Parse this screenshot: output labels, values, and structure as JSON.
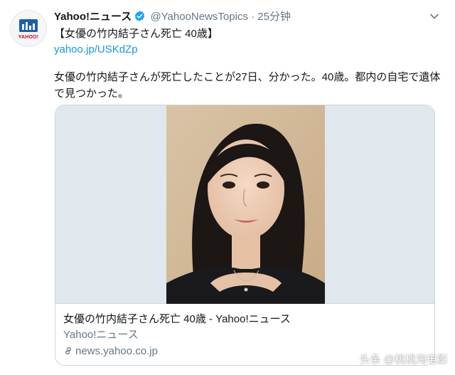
{
  "tweet": {
    "display_name": "Yahoo!ニュース",
    "handle": "@YahooNewsTopics",
    "separator": "·",
    "time": "25分钟",
    "title_line": "【女優の竹内結子さん死亡 40歳】",
    "short_link": "yahoo.jp/USKdZp",
    "body": "女優の竹内結子さんが死亡したことが27日、分かった。40歳。都内の自宅で遺体で見つかった。"
  },
  "avatar": {
    "logo_text": "YAHOO!"
  },
  "card": {
    "title": "女優の竹内結子さん死亡 40歳 - Yahoo!ニュース",
    "source": "Yahoo!ニュース",
    "domain": "news.yahoo.co.jp"
  },
  "watermark": {
    "text": "头条 @桃桃淘电影"
  },
  "icons": {
    "verified": "verified-badge-icon",
    "caret": "chevron-down-icon",
    "link": "link-icon"
  },
  "colors": {
    "link": "#1b95e0",
    "secondary": "#657786",
    "verified": "#1da1f2",
    "border": "#ccd6dd"
  }
}
